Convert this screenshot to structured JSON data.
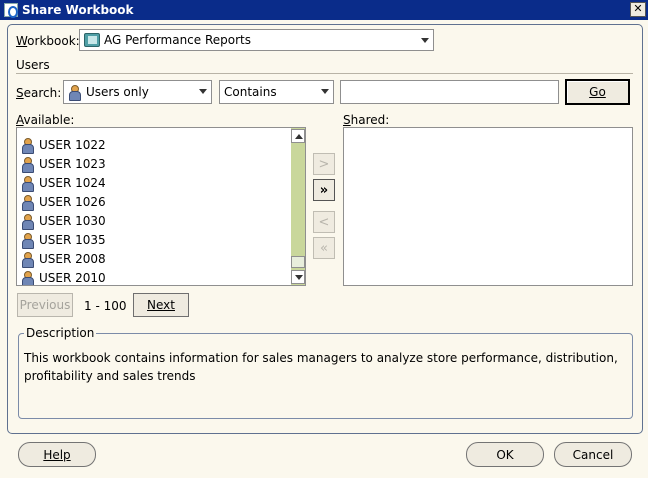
{
  "window": {
    "title": "Share Workbook"
  },
  "workbook": {
    "label": "Workbook:",
    "selected": "AG Performance Reports",
    "icon": "workbook-icon"
  },
  "users_section": {
    "label": "Users"
  },
  "search": {
    "label": "Search:",
    "type_selected": "Users only",
    "condition_selected": "Contains",
    "query_value": "",
    "go_label": "Go"
  },
  "available": {
    "label": "Available:",
    "items": [
      "USER 1022",
      "USER 1023",
      "USER 1024",
      "USER 1026",
      "USER 1030",
      "USER 1035",
      "USER 2008",
      "USER 2010"
    ]
  },
  "shared": {
    "label": "Shared:",
    "items": []
  },
  "shuttle": {
    "move": ">",
    "move_all": "»",
    "remove": "<",
    "remove_all": "«"
  },
  "paging": {
    "previous_label": "Previous",
    "range": "1 - 100",
    "next_label": "Next"
  },
  "description": {
    "label": "Description",
    "text": "This workbook contains information for sales managers to analyze store performance, distribution, profitability and sales trends"
  },
  "footer": {
    "help_label": "Help",
    "ok_label": "OK",
    "cancel_label": "Cancel"
  },
  "colors": {
    "title_bar": "#0a2c8a",
    "dialog_bg": "#fbf8ed",
    "button_bg": "#efebe0",
    "scroll_track": "#c9d79b",
    "group_border": "#7b8ba8"
  }
}
